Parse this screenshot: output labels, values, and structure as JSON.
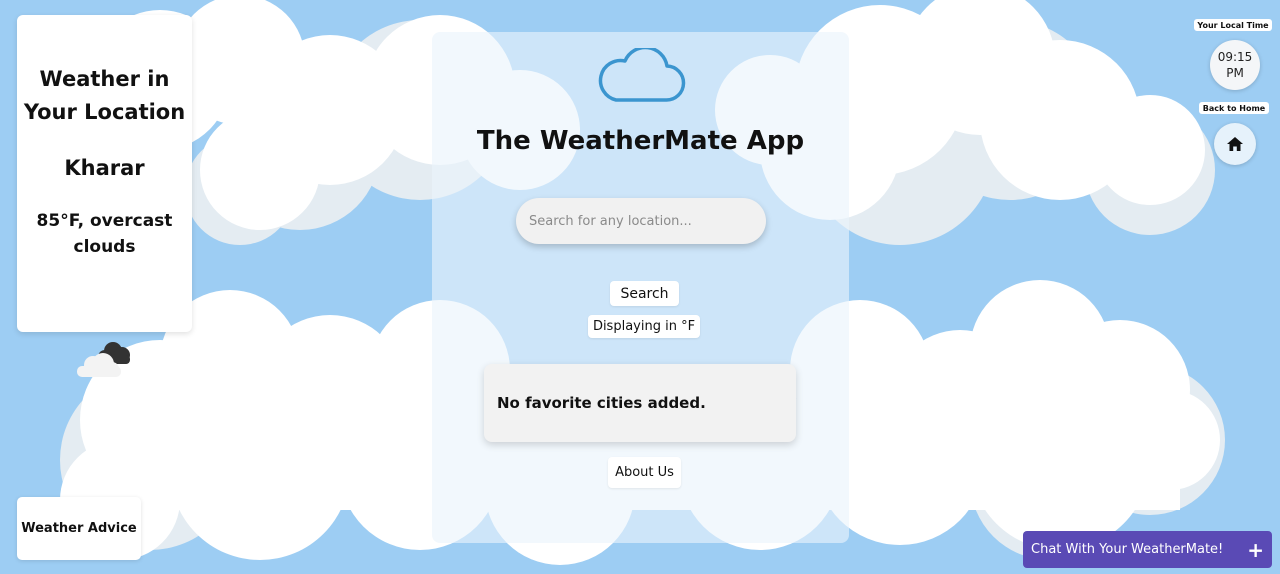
{
  "location_card": {
    "title": "Weather in Your Location",
    "city": "Kharar",
    "weather": "85°F, overcast clouds"
  },
  "advice": {
    "label": "Weather Advice"
  },
  "app": {
    "title": "The WeatherMate App",
    "search_placeholder": "Search for any location...",
    "search_button": "Search",
    "unit_toggle": "Displaying in °F",
    "favorites_empty": "No favorite cities added.",
    "about_button": "About Us"
  },
  "clock": {
    "label": "Your Local Time",
    "time": "09:15",
    "period": "PM"
  },
  "home": {
    "label": "Back to Home"
  },
  "chat": {
    "label": "Chat With Your WeatherMate!",
    "plus": "+"
  },
  "icons": {
    "app_logo": "cloud-icon",
    "weather_condition": "overcast-clouds-icon",
    "home": "home-icon",
    "chat_plus": "plus-icon"
  },
  "colors": {
    "sky_background": "#9dcdf3",
    "chat_button": "#5a4ab5",
    "cloud_icon_stroke": "#3b95cf"
  }
}
